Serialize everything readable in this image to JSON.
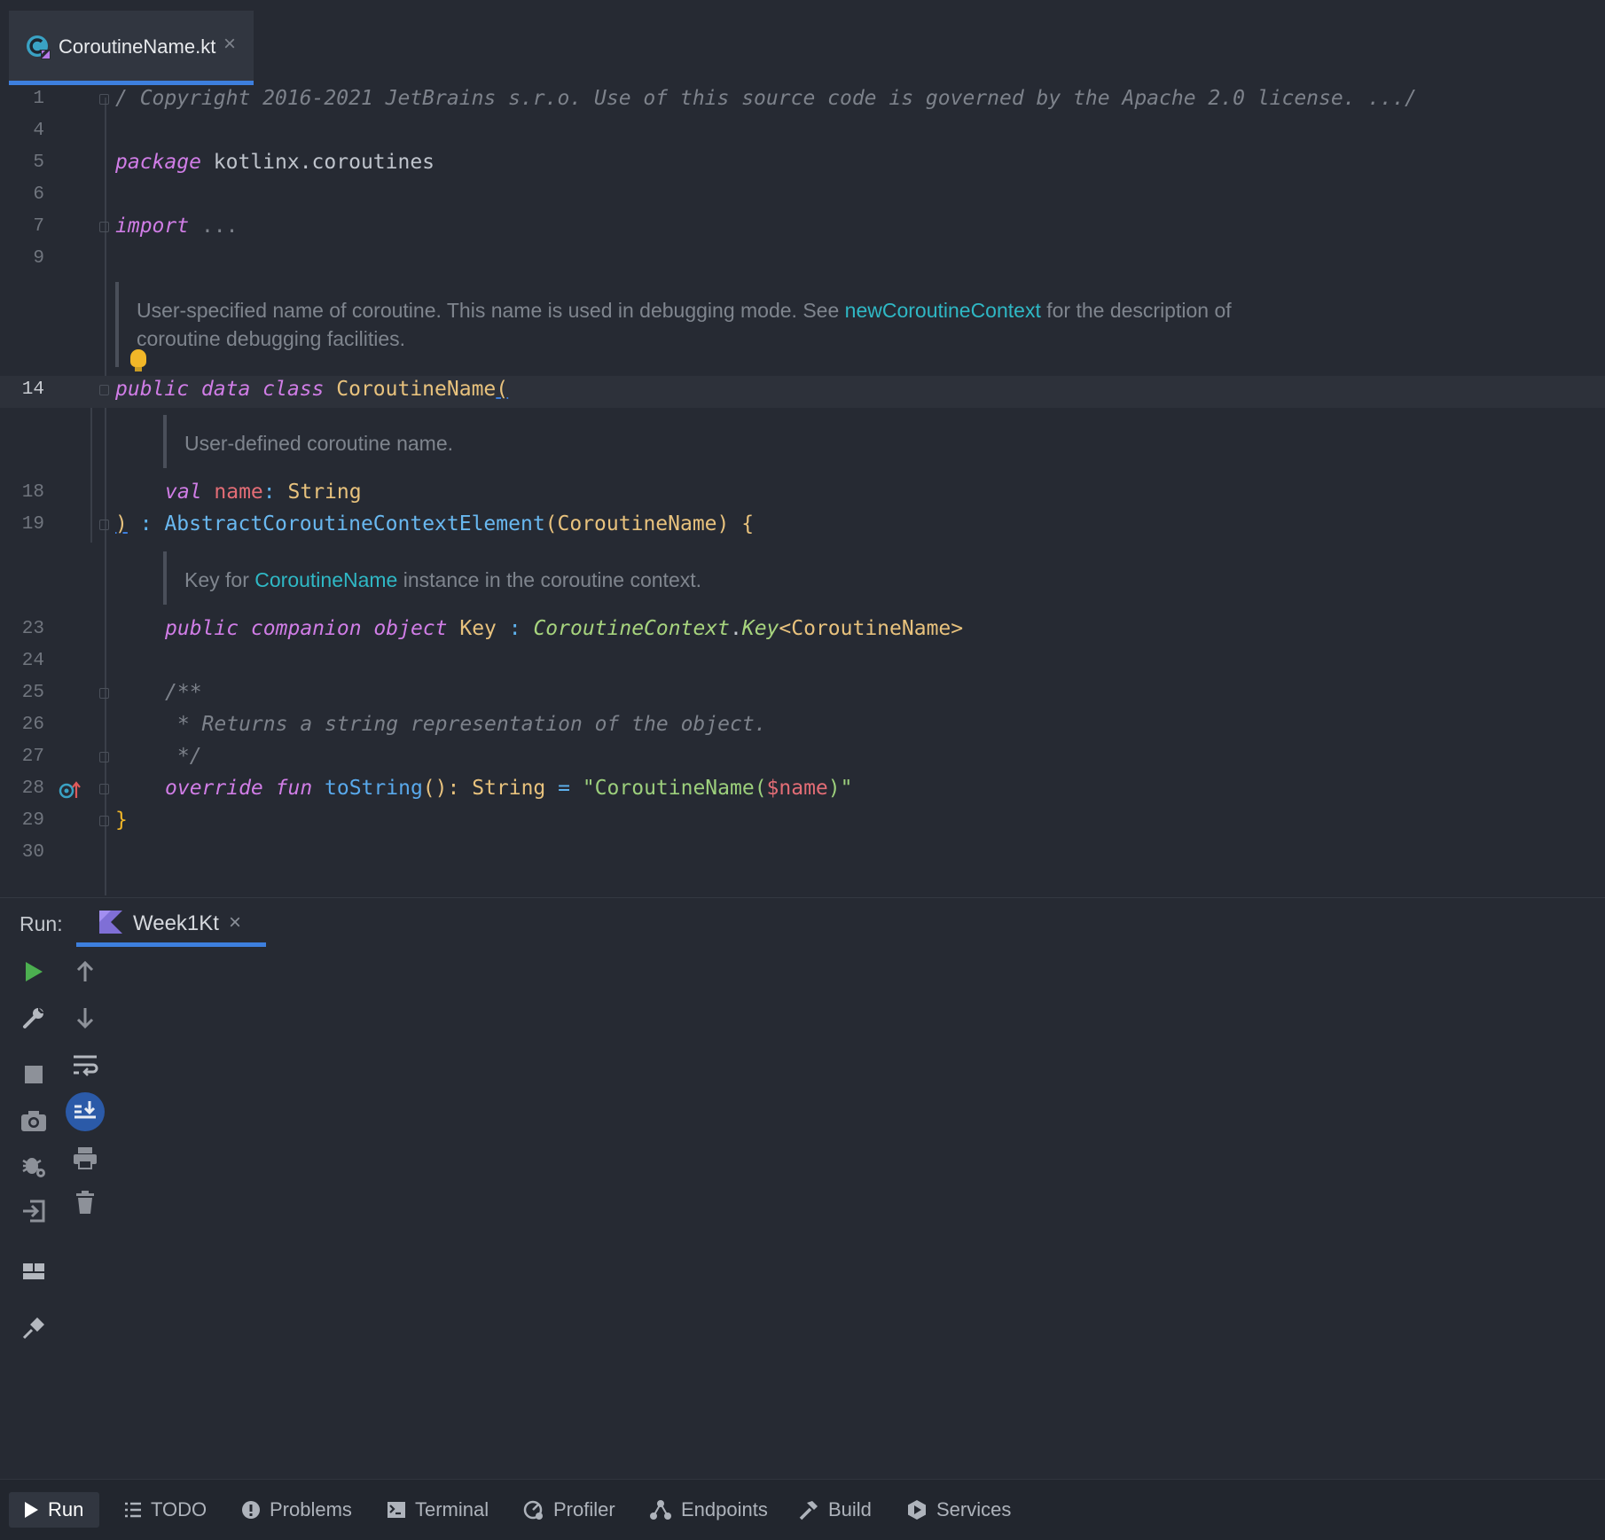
{
  "editor_tab": {
    "file_name": "CoroutineName.kt",
    "icon": "kotlin-class-file-icon",
    "close_glyph": "×"
  },
  "code": {
    "line_numbers": {
      "l1": "1",
      "l4": "4",
      "l5": "5",
      "l6": "6",
      "l7": "7",
      "l9": "9",
      "l14": "14",
      "l18": "18",
      "l19": "19",
      "l23": "23",
      "l24": "24",
      "l25": "25",
      "l26": "26",
      "l27": "27",
      "l28": "28",
      "l29": "29",
      "l30": "30"
    },
    "line1": {
      "text": "/ Copyright 2016-2021 JetBrains s.r.o. Use of this source code is governed by the Apache 2.0 license. .../"
    },
    "line5": {
      "kw": "package",
      "rest": " kotlinx.coroutines"
    },
    "line7": {
      "kw": "import",
      "rest": " ..."
    },
    "doc1": {
      "part1": "User-specified name of coroutine. This name is used in debugging mode. See ",
      "link": "newCoroutineContext",
      "part2": " for the description of coroutine debugging facilities."
    },
    "line14": {
      "kw": "public data class",
      "name": " CoroutineName",
      "paren": "("
    },
    "doc2": {
      "text": "User-defined coroutine name."
    },
    "line18": {
      "kw": "val",
      "prop": " name",
      "colon": ":",
      "type": " String"
    },
    "line19": {
      "paren": ")",
      "sep": " : ",
      "type": "AbstractCoroutineContextElement",
      "arg": "(CoroutineName) {"
    },
    "doc3": {
      "part1": "Key for ",
      "link": "CoroutineName",
      "part2": " instance in the coroutine context."
    },
    "line23": {
      "kw": "public companion object",
      "name": " Key",
      "sep": " : ",
      "itype": "CoroutineContext",
      "dot": ".",
      "ikey": "Key",
      "generic": "<CoroutineName>"
    },
    "line25": {
      "text": "/**"
    },
    "line26": {
      "text": " * Returns a string representation of the object."
    },
    "line27": {
      "text": " */"
    },
    "line28": {
      "kw": "override fun",
      "fn": " toString",
      "parens": "():",
      "type": " String",
      "eq": " = ",
      "str1": "\"CoroutineName(",
      "tmpl": "$name",
      "str2": ")\""
    },
    "line29": {
      "brace": "}"
    }
  },
  "run_panel": {
    "label": "Run:",
    "tab_label": "Week1Kt",
    "close_glyph": "×"
  },
  "bottom_bar": {
    "items": [
      {
        "label": "Run",
        "icon": "play-icon"
      },
      {
        "label": "TODO",
        "icon": "list-icon"
      },
      {
        "label": "Problems",
        "icon": "warning-circle-icon"
      },
      {
        "label": "Terminal",
        "icon": "terminal-icon"
      },
      {
        "label": "Profiler",
        "icon": "profiler-icon"
      },
      {
        "label": "Endpoints",
        "icon": "endpoints-icon"
      },
      {
        "label": "Build",
        "icon": "hammer-icon"
      },
      {
        "label": "Services",
        "icon": "services-icon"
      }
    ]
  },
  "colors": {
    "background": "#262a33",
    "accent": "#3d7fde",
    "keyword": "#d07de6",
    "class_name": "#e8c27d",
    "type": "#69b8f0",
    "string": "#9ccf7c",
    "property": "#e36d76",
    "doc_link": "#2fb8c5",
    "run_green": "#4caf50"
  }
}
